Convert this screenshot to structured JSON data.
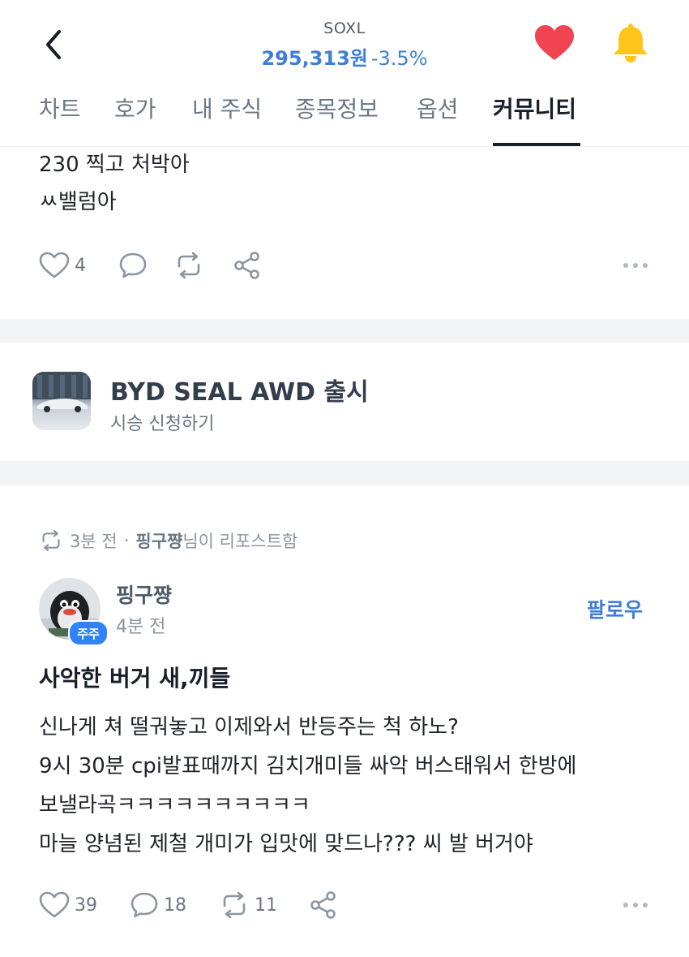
{
  "header": {
    "ticker": "SOXL",
    "price": "295,313원",
    "change": "-3.5%",
    "back_icon": "chevron-left-icon",
    "favorite_icon": "heart-icon",
    "alarm_icon": "bell-icon",
    "colors": {
      "price": "#3d7fd6",
      "heart": "#f04452",
      "bell": "#ffc51a"
    }
  },
  "tabs": [
    {
      "label": "차트",
      "active": false
    },
    {
      "label": "호가",
      "active": false
    },
    {
      "label": "내 주식",
      "active": false
    },
    {
      "label": "종목정보",
      "active": false
    },
    {
      "label": "옵션",
      "active": false
    },
    {
      "label": "커뮤니티",
      "active": true
    }
  ],
  "post1": {
    "lines": [
      "230 찍고 처박아",
      "ㅆ밸럼아"
    ],
    "likes": "4"
  },
  "ad": {
    "title": "BYD SEAL AWD 출시",
    "subtitle": "시승 신청하기"
  },
  "post2": {
    "repost": {
      "time": "3분 전",
      "dot": "·",
      "user": "핑구쨩",
      "suffix": "님이 리포스트함"
    },
    "author": "핑구쨩",
    "badge": "주주",
    "time": "4분 전",
    "follow_label": "팔로우",
    "title": "사악한 버거 새,끼들",
    "lines": [
      "신나게 쳐 떨궈놓고 이제와서 반등주는 척 하노?",
      "9시 30분 cpi발표때까지 김치개미들 싸악 버스태워서 한방에",
      "보낼라곡ㅋㅋㅋㅋㅋㅋㅋㅋㅋㅋ",
      "마늘 양념된 제철 개미가 입맛에 맞드나??? 씨 발 버거야"
    ],
    "likes": "39",
    "comments": "18",
    "reposts": "11"
  }
}
